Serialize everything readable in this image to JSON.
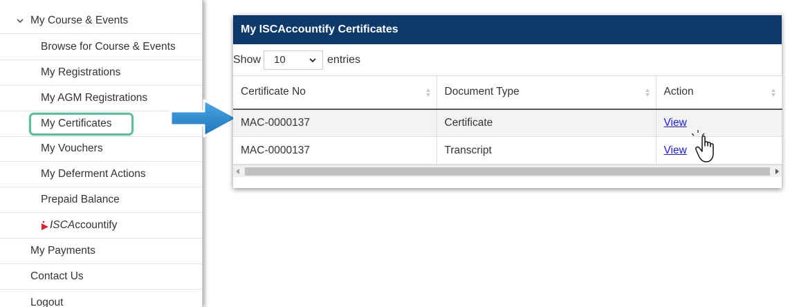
{
  "sidebar": {
    "section": {
      "label": "My Course & Events",
      "icon": "chevron-down-icon"
    },
    "items": [
      {
        "label": "Browse for Course & Events"
      },
      {
        "label": "My Registrations"
      },
      {
        "label": "My AGM Registrations"
      },
      {
        "label": "My Certificates",
        "highlighted": true
      },
      {
        "label": "My Vouchers"
      },
      {
        "label": "My Deferment Actions"
      },
      {
        "label": "Prepaid Balance"
      },
      {
        "label_prefix": "ISCA",
        "label_suffix": "ccountify",
        "icon": "isca-logo-icon"
      }
    ],
    "top_items": [
      {
        "label": "My Payments"
      },
      {
        "label": "Contact Us"
      },
      {
        "label": "Logout"
      }
    ],
    "highlight_color": "#5dbf9a"
  },
  "panel": {
    "title": "My ISCAccountify Certificates",
    "header_color": "#0e3a6b",
    "show_label": "Show",
    "entries_value": "10",
    "entries_label": "entries",
    "columns": [
      "Certificate No",
      "Document Type",
      "Action"
    ],
    "rows": [
      {
        "certificate_no": "MAC-0000137",
        "document_type": "Certificate",
        "action": "View"
      },
      {
        "certificate_no": "MAC-0000137",
        "document_type": "Transcript",
        "action": "View"
      }
    ],
    "link_color": "#1a1aee"
  },
  "annotation": {
    "arrow_icon": "arrow-right-icon",
    "arrow_color": "#2f8fd6",
    "cursor_icon": "hand-pointer-icon"
  }
}
